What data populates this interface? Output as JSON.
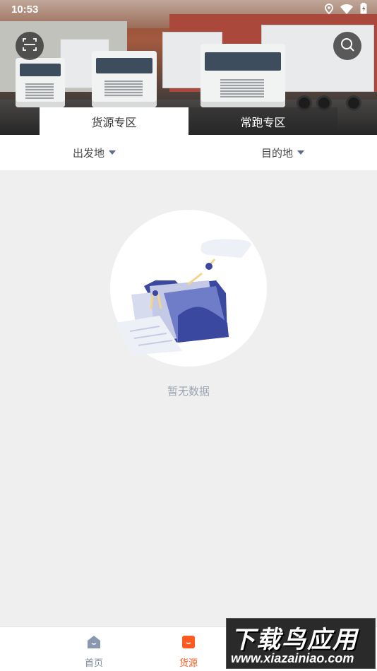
{
  "status_bar": {
    "time": "10:53"
  },
  "banner_tabs": [
    {
      "label": "货源专区"
    },
    {
      "label": "常跑专区"
    }
  ],
  "filters": {
    "origin": "出发地",
    "destination": "目的地"
  },
  "empty_state": {
    "text": "暂无数据"
  },
  "bottom_nav": [
    {
      "label": "首页"
    },
    {
      "label": "货源"
    }
  ],
  "colors": {
    "accent": "#ff5a1f",
    "muted": "#9ba3b3",
    "illustration": "#3b4a9e"
  },
  "watermark": {
    "title": "下载鸟应用",
    "site": "www.xiazainiao.com"
  }
}
